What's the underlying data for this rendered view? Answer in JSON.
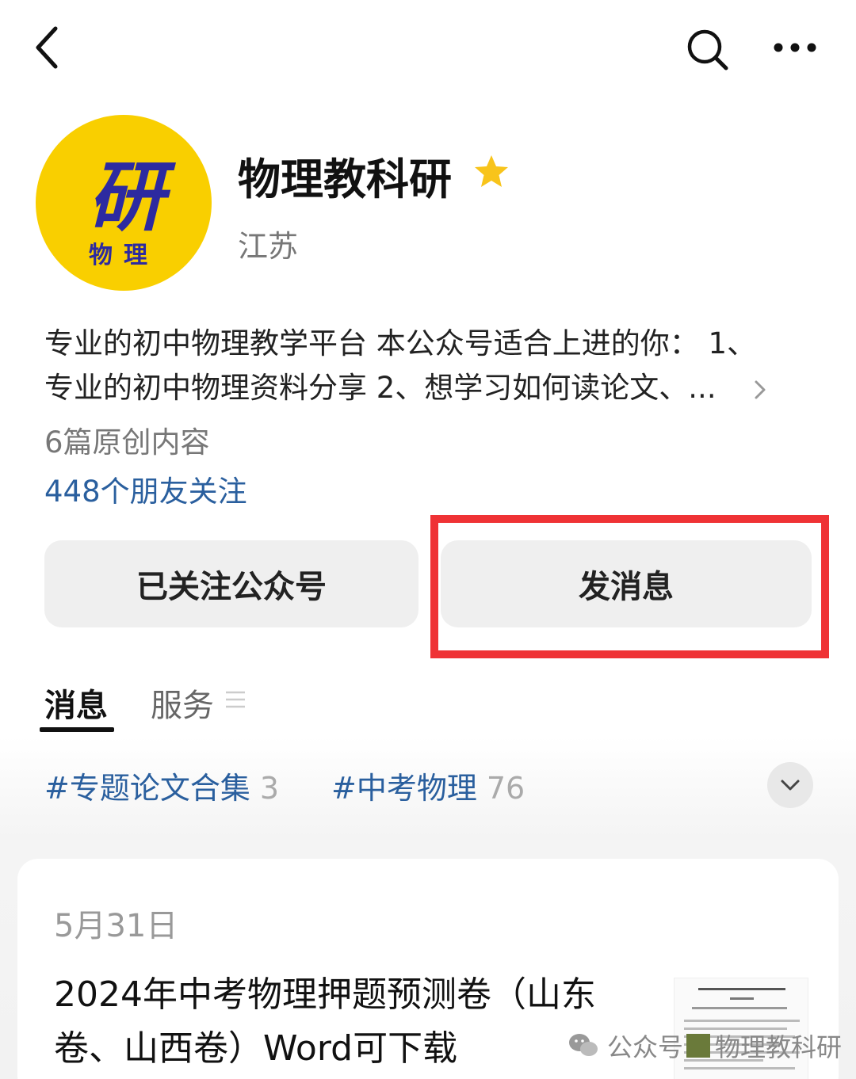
{
  "account": {
    "name": "物理教科研",
    "region": "江苏",
    "avatar_main_char": "研",
    "avatar_sub_text": "物理",
    "description_line1": "专业的初中物理教学平台 本公众号适合上进的你： 1、",
    "description_line2": "专业的初中物理资料分享 2、想学习如何读论文、...",
    "original_count": "6篇原创内容",
    "followers": "448个朋友关注"
  },
  "actions": {
    "followed_label": "已关注公众号",
    "message_label": "发消息"
  },
  "tabs": {
    "messages": "消息",
    "services": "服务"
  },
  "tags": [
    {
      "label": "#专题论文合集",
      "count": "3"
    },
    {
      "label": "#中考物理",
      "count": "76"
    }
  ],
  "article": {
    "date": "5月31日",
    "title": "2024年中考物理押题预测卷（山东卷、山西卷）Word可下载"
  },
  "watermark": {
    "prefix": "公众号",
    "name": "物理教科研"
  },
  "colors": {
    "avatar_bg": "#f9cf00",
    "avatar_text": "#2d2aa0",
    "link_blue": "#2a5f9e",
    "highlight_red": "#ef3235",
    "star": "#f8c41b"
  },
  "icons": [
    "back-icon",
    "search-icon",
    "more-icon",
    "star-icon",
    "chevron-right-icon",
    "menu-icon",
    "chevron-down-icon",
    "wechat-icon"
  ]
}
